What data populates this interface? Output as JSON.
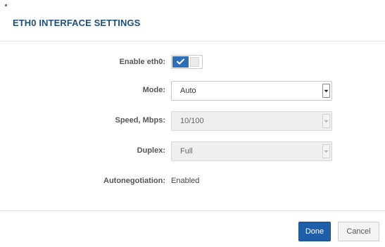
{
  "dialog": {
    "title": "ETH0 INTERFACE SETTINGS"
  },
  "form": {
    "enable": {
      "label": "Enable eth0:",
      "checked": true,
      "icon": "check-icon",
      "accent_color": "#2d6fb8"
    },
    "mode": {
      "label": "Mode:",
      "value": "Auto",
      "disabled": false
    },
    "speed": {
      "label": "Speed, Mbps:",
      "value": "10/100",
      "disabled": true
    },
    "duplex": {
      "label": "Duplex:",
      "value": "Full",
      "disabled": true
    },
    "autonegotiation": {
      "label": "Autonegotiation:",
      "value": "Enabled"
    }
  },
  "footer": {
    "done_label": "Done",
    "cancel_label": "Cancel",
    "primary_color": "#1f5ea8"
  }
}
